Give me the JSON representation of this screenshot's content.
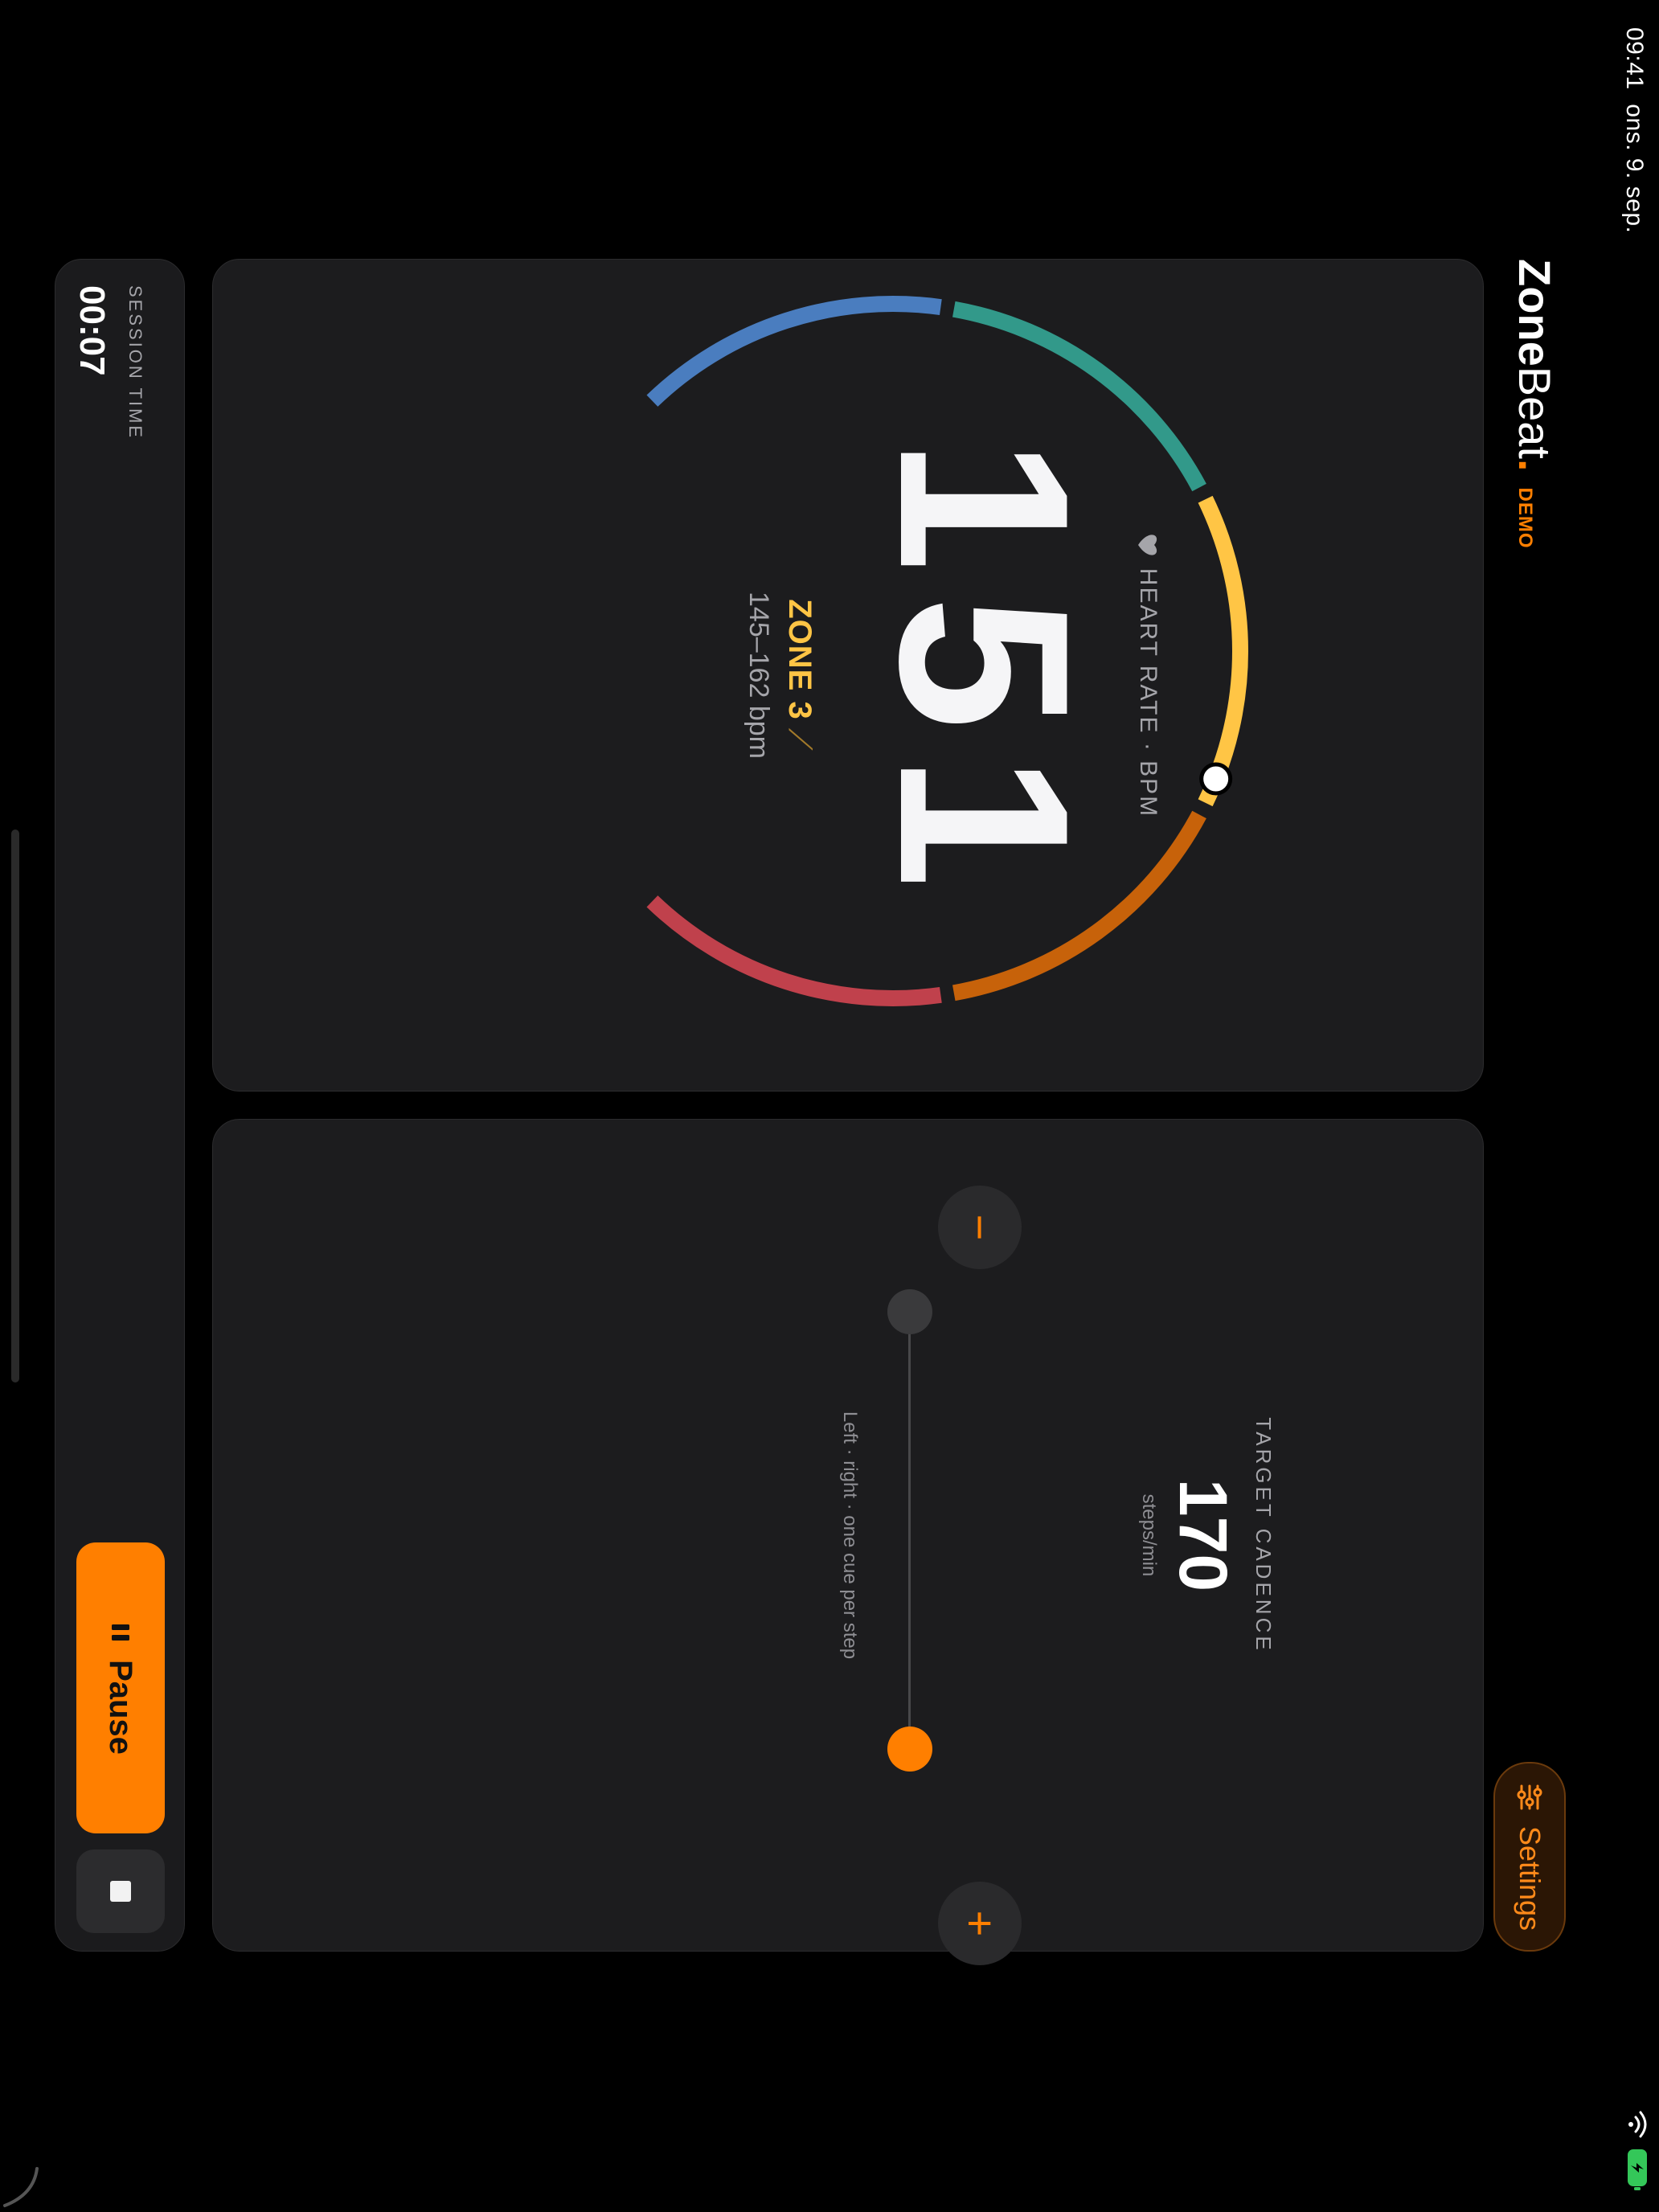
{
  "status_bar": {
    "time": "09:41",
    "date": "ons. 9. sep."
  },
  "header": {
    "brand_zone": "Zone",
    "brand_beat": "Beat",
    "brand_dot": ".",
    "demo_label": "DEMO",
    "settings_label": "Settings"
  },
  "heart_rate": {
    "label": "HEART RATE · BPM",
    "value": "151",
    "zone_label": "ZONE 3",
    "zone_trend": "⟋",
    "zone_range": "145–162 bpm",
    "zone_colors": [
      "#4a7dbf",
      "#32998a",
      "#ffc545",
      "#c7620a",
      "#c0414c"
    ],
    "indicator_fraction": 0.58
  },
  "cadence": {
    "label": "TARGET CADENCE",
    "value": "170",
    "unit": "steps/min",
    "minus_label": "−",
    "plus_label": "+",
    "hint": "Left · right · one cue per step"
  },
  "session": {
    "time_label": "SESSION TIME",
    "time_value": "00:07",
    "pause_label": "Pause"
  }
}
